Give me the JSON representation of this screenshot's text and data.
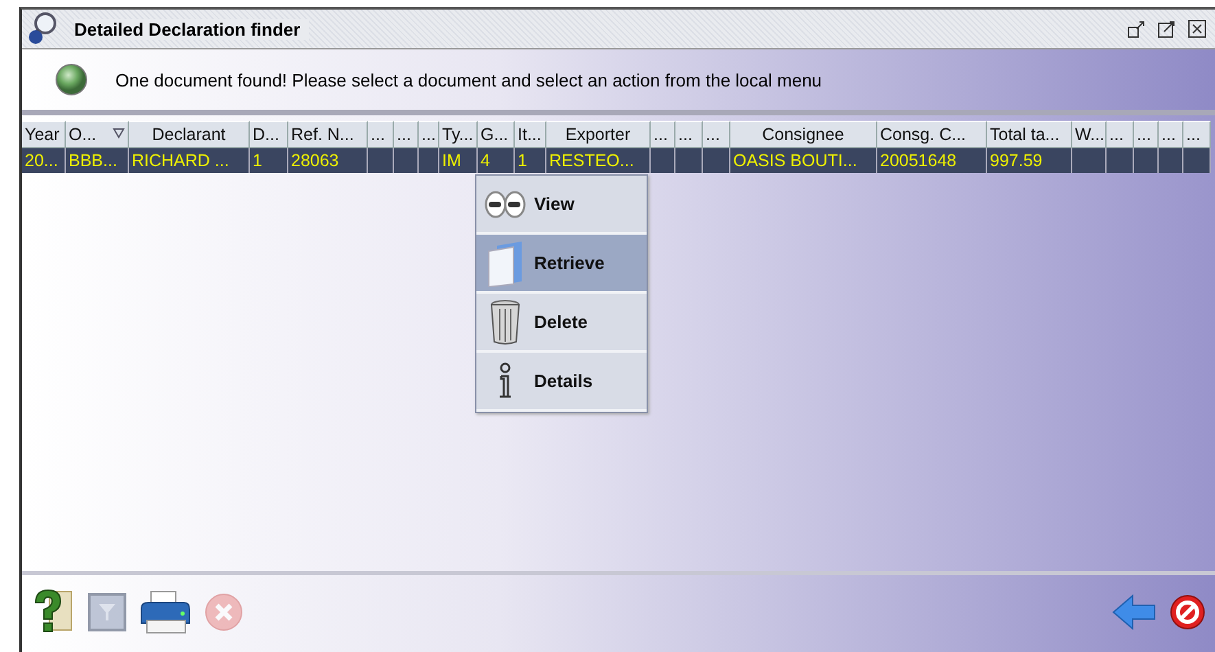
{
  "window": {
    "title": "Detailed Declaration finder"
  },
  "message": {
    "text": "One document found! Please select a document and select an action from the local menu"
  },
  "table": {
    "columns": [
      {
        "label": "Year",
        "sorted": false
      },
      {
        "label": "O...",
        "sorted": true
      },
      {
        "label": "Declarant",
        "sorted": false
      },
      {
        "label": "D...",
        "sorted": false
      },
      {
        "label": "Ref. N...",
        "sorted": false
      },
      {
        "label": "...",
        "sorted": false
      },
      {
        "label": "...",
        "sorted": false
      },
      {
        "label": "...",
        "sorted": false
      },
      {
        "label": "Ty...",
        "sorted": false
      },
      {
        "label": "G...",
        "sorted": false
      },
      {
        "label": "It...",
        "sorted": false
      },
      {
        "label": "Exporter",
        "sorted": false
      },
      {
        "label": "...",
        "sorted": false
      },
      {
        "label": "...",
        "sorted": false
      },
      {
        "label": "...",
        "sorted": false
      },
      {
        "label": "Consignee",
        "sorted": false
      },
      {
        "label": "Consg. C...",
        "sorted": false
      },
      {
        "label": "Total ta...",
        "sorted": false
      },
      {
        "label": "W...",
        "sorted": false
      },
      {
        "label": "...",
        "sorted": false
      },
      {
        "label": "...",
        "sorted": false
      },
      {
        "label": "...",
        "sorted": false
      },
      {
        "label": "...",
        "sorted": false
      }
    ],
    "rows": [
      {
        "selected": true,
        "cells": [
          "20...",
          "BBB...",
          "RICHARD ...",
          "1",
          "28063",
          "",
          "",
          "",
          "IM",
          "4",
          "1",
          "RESTEO...",
          "",
          "",
          "",
          "OASIS BOUTI...",
          "20051648",
          "997.59",
          "",
          "",
          "",
          "",
          ""
        ]
      }
    ]
  },
  "context_menu": {
    "items": [
      {
        "kind": "view",
        "label": "View",
        "selected": false
      },
      {
        "kind": "retrieve",
        "label": "Retrieve",
        "selected": true
      },
      {
        "kind": "delete",
        "label": "Delete",
        "selected": false
      },
      {
        "kind": "details",
        "label": "Details",
        "selected": false
      }
    ]
  },
  "toolbar": {
    "left": [
      {
        "kind": "help",
        "disabled": false
      },
      {
        "kind": "filter",
        "disabled": true
      },
      {
        "kind": "print",
        "disabled": false
      },
      {
        "kind": "cancel",
        "disabled": true
      }
    ],
    "right": [
      {
        "kind": "back",
        "disabled": false
      },
      {
        "kind": "stop",
        "disabled": false
      }
    ]
  }
}
